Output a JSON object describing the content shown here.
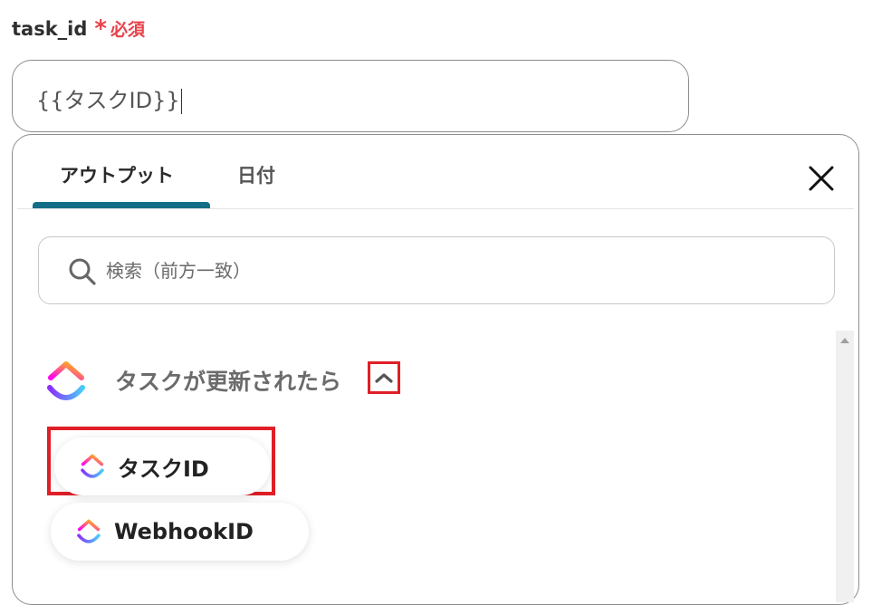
{
  "field": {
    "label": "task_id",
    "required_mark": "*",
    "required_text": "必須",
    "value": "{{タスクID}}"
  },
  "panel": {
    "tabs": [
      {
        "label": "アウトプット",
        "active": true
      },
      {
        "label": "日付",
        "active": false
      }
    ],
    "close_icon": "close-icon",
    "search": {
      "placeholder": "検索（前方一致）",
      "icon": "search-icon"
    },
    "group": {
      "title": "タスクが更新されたら",
      "expanded": true,
      "toggle_icon": "chevron-up-icon",
      "items": [
        {
          "label": "タスクID"
        },
        {
          "label": "WebhookID"
        }
      ]
    }
  },
  "colors": {
    "accent": "#146d87",
    "required": "#e8424a",
    "highlight_box": "#e01f26"
  }
}
